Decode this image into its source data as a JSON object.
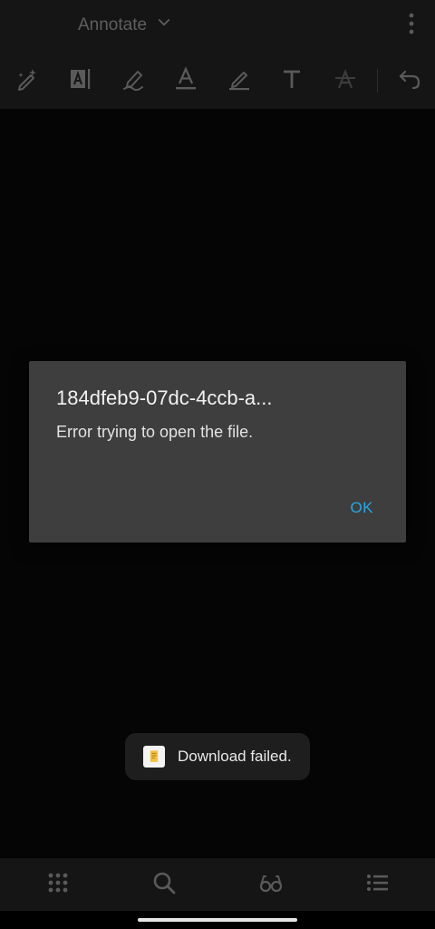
{
  "topbar": {
    "mode_label": "Annotate",
    "mode_icon": "chevron-down-icon",
    "overflow_icon": "more-vertical-icon"
  },
  "toolbar": {
    "tools": [
      {
        "name": "magic-pen-icon"
      },
      {
        "name": "text-box-icon"
      },
      {
        "name": "highlighter-icon"
      },
      {
        "name": "text-underline-icon"
      },
      {
        "name": "pen-icon"
      },
      {
        "name": "text-tool-icon"
      },
      {
        "name": "strikethrough-icon"
      },
      {
        "name": "undo-icon"
      }
    ]
  },
  "dialog": {
    "title": "184dfeb9-07dc-4ccb-a...",
    "message": "Error trying to open the file.",
    "ok_label": "OK"
  },
  "toast": {
    "message": "Download failed."
  },
  "bottom_nav": {
    "items": [
      {
        "name": "grid-icon"
      },
      {
        "name": "search-icon"
      },
      {
        "name": "reading-glasses-icon"
      },
      {
        "name": "outline-list-icon"
      }
    ]
  },
  "colors": {
    "background": "#050505",
    "bar": "#151515",
    "dialog": "#3e3e3e",
    "accent": "#2aa6e4",
    "icon": "#5a5a5a"
  }
}
